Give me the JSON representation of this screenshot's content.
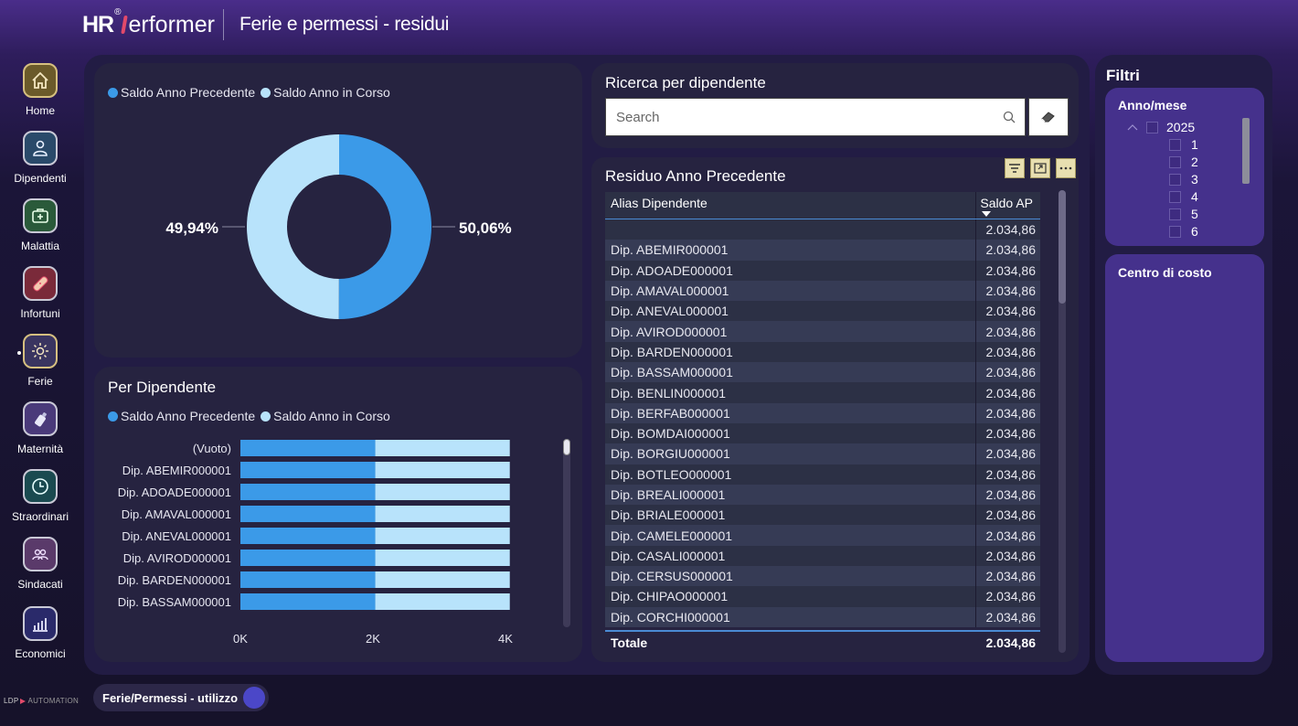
{
  "header": {
    "logo_hr": "HR",
    "logo_reg": "®",
    "logo_rest": "erformer",
    "title": "Ferie e permessi - residui"
  },
  "nav": {
    "items": [
      {
        "label": "Home",
        "icon": "home-icon"
      },
      {
        "label": "Dipendenti",
        "icon": "person-icon"
      },
      {
        "label": "Malattia",
        "icon": "medical-kit-icon"
      },
      {
        "label": "Infortuni",
        "icon": "bandage-icon"
      },
      {
        "label": "Ferie",
        "icon": "sun-icon"
      },
      {
        "label": "Maternità",
        "icon": "baby-bottle-icon"
      },
      {
        "label": "Straordinari",
        "icon": "clock-icon"
      },
      {
        "label": "Sindacati",
        "icon": "group-icon"
      },
      {
        "label": "Economici",
        "icon": "bar-chart-icon"
      }
    ]
  },
  "legend": {
    "series_1": "Saldo Anno Precedente",
    "series_2": "Saldo Anno in Corso"
  },
  "colors": {
    "series_1": "#3b9ae8",
    "series_2": "#b8e3fb"
  },
  "donut": {
    "left_label": "49,94%",
    "right_label": "50,06%"
  },
  "bar_card": {
    "title": "Per Dipendente"
  },
  "search": {
    "title": "Ricerca per dipendente",
    "placeholder": "Search"
  },
  "table": {
    "title": "Residuo Anno Precedente",
    "col1": "Alias Dipendente",
    "col2": "Saldo AP",
    "rows": [
      {
        "name": "",
        "value": "2.034,86"
      },
      {
        "name": "Dip. ABEMIR000001",
        "value": "2.034,86"
      },
      {
        "name": "Dip. ADOADE000001",
        "value": "2.034,86"
      },
      {
        "name": "Dip. AMAVAL000001",
        "value": "2.034,86"
      },
      {
        "name": "Dip. ANEVAL000001",
        "value": "2.034,86"
      },
      {
        "name": "Dip. AVIROD000001",
        "value": "2.034,86"
      },
      {
        "name": "Dip. BARDEN000001",
        "value": "2.034,86"
      },
      {
        "name": "Dip. BASSAM000001",
        "value": "2.034,86"
      },
      {
        "name": "Dip. BENLIN000001",
        "value": "2.034,86"
      },
      {
        "name": "Dip. BERFAB000001",
        "value": "2.034,86"
      },
      {
        "name": "Dip. BOMDAI000001",
        "value": "2.034,86"
      },
      {
        "name": "Dip. BORGIU000001",
        "value": "2.034,86"
      },
      {
        "name": "Dip. BOTLEO000001",
        "value": "2.034,86"
      },
      {
        "name": "Dip. BREALI000001",
        "value": "2.034,86"
      },
      {
        "name": "Dip. BRIALE000001",
        "value": "2.034,86"
      },
      {
        "name": "Dip. CAMELE000001",
        "value": "2.034,86"
      },
      {
        "name": "Dip. CASALI000001",
        "value": "2.034,86"
      },
      {
        "name": "Dip. CERSUS000001",
        "value": "2.034,86"
      },
      {
        "name": "Dip. CHIPAO000001",
        "value": "2.034,86"
      },
      {
        "name": "Dip. CORCHI000001",
        "value": "2.034,86"
      }
    ],
    "total_label": "Totale",
    "total_value": "2.034,86"
  },
  "filters": {
    "title": "Filtri",
    "anno_mese": {
      "title": "Anno/mese",
      "year": "2025",
      "months": [
        "1",
        "2",
        "3",
        "4",
        "5",
        "6"
      ]
    },
    "centro": {
      "title": "Centro di costo"
    }
  },
  "toggle": {
    "label": "Ferie/Permessi - utilizzo"
  },
  "brand": {
    "text_a": "LDP",
    "text_b": "AUTOMATION"
  },
  "chart_data": [
    {
      "type": "pie",
      "categories": [
        "Saldo Anno Precedente",
        "Saldo Anno in Corso"
      ],
      "values": [
        50.06,
        49.94
      ],
      "labels": [
        "50,06%",
        "49,94%"
      ],
      "legend": "top-left"
    },
    {
      "type": "bar",
      "title": "Per Dipendente",
      "categories": [
        "(Vuoto)",
        "Dip. ABEMIR000001",
        "Dip. ADOADE000001",
        "Dip. AMAVAL000001",
        "Dip. ANEVAL000001",
        "Dip. AVIROD000001",
        "Dip. BARDEN000001",
        "Dip. BASSAM000001"
      ],
      "series": [
        {
          "name": "Saldo Anno Precedente",
          "values": [
            2035,
            2035,
            2035,
            2035,
            2035,
            2035,
            2035,
            2035
          ]
        },
        {
          "name": "Saldo Anno in Corso",
          "values": [
            2030,
            2030,
            2030,
            2030,
            2030,
            2030,
            2030,
            2030
          ]
        }
      ],
      "stacked": true,
      "orientation": "horizontal",
      "xlim": [
        0,
        4000
      ],
      "xticks": [
        "0K",
        "2K",
        "4K"
      ],
      "legend": "top-left"
    }
  ]
}
